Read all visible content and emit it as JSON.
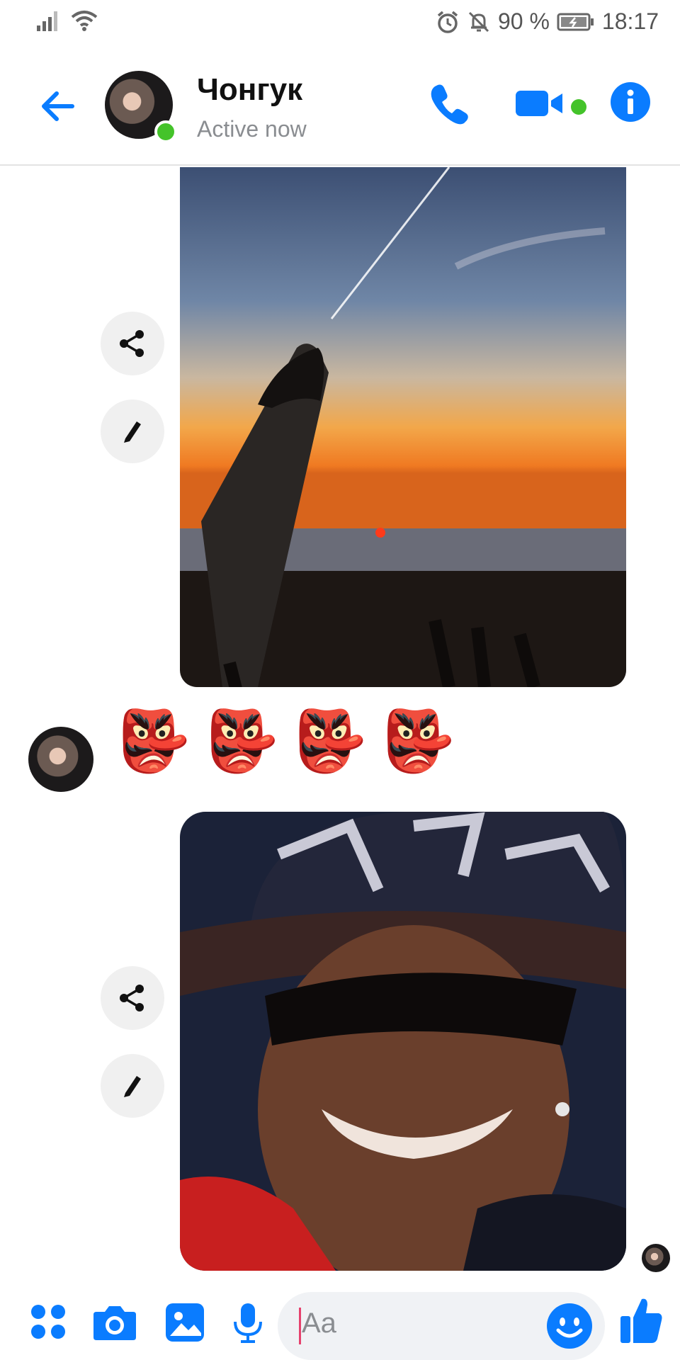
{
  "status_bar": {
    "battery": "90 %",
    "time": "18:17"
  },
  "header": {
    "contact_name": "Чонгук",
    "status": "Active now"
  },
  "messages": {
    "emoji_message": [
      "👺",
      "👺",
      "👺",
      "👺"
    ]
  },
  "composer": {
    "placeholder": "Aa"
  },
  "colors": {
    "accent": "#0a7cff",
    "online": "#44c32a"
  }
}
